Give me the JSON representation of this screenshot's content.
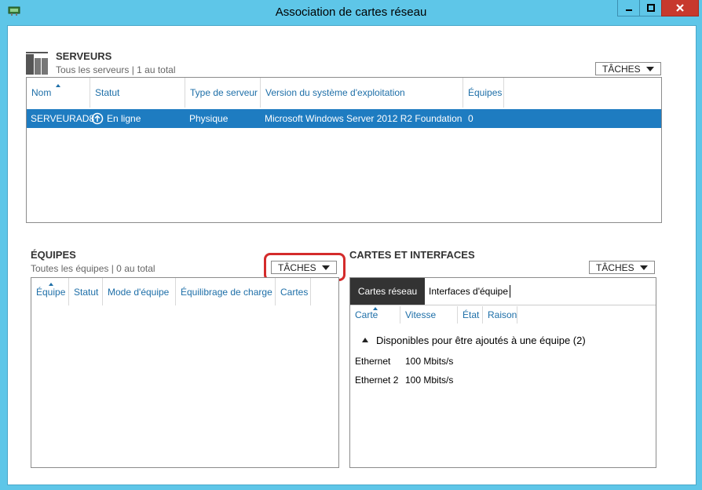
{
  "window": {
    "title": "Association de cartes réseau"
  },
  "servers": {
    "title": "SERVEURS",
    "subtitle": "Tous les serveurs | 1 au total",
    "tasks_label": "TÂCHES",
    "columns": [
      "Nom",
      "Statut",
      "Type de serveur",
      "Version du système d'exploitation",
      "Équipes"
    ],
    "rows": [
      {
        "name": "SERVEURAD8",
        "status": "En ligne",
        "type": "Physique",
        "os": "Microsoft Windows Server 2012 R2 Foundation",
        "teams": "0"
      }
    ]
  },
  "teams": {
    "title": "ÉQUIPES",
    "subtitle": "Toutes les équipes | 0 au total",
    "tasks_label": "TÂCHES",
    "columns": [
      "Équipe",
      "Statut",
      "Mode d'équipe",
      "Équilibrage de charge",
      "Cartes"
    ]
  },
  "adapters": {
    "title": "CARTES ET INTERFACES",
    "tasks_label": "TÂCHES",
    "tabs": [
      "Cartes réseau",
      "Interfaces d'équipe"
    ],
    "columns": [
      "Carte",
      "Vitesse",
      "État",
      "Raison"
    ],
    "group_label": "Disponibles pour être ajoutés à une équipe (2)",
    "rows": [
      {
        "name": "Ethernet",
        "speed": "100 Mbits/s"
      },
      {
        "name": "Ethernet 2",
        "speed": "100 Mbits/s"
      }
    ]
  },
  "colors": {
    "accent": "#1e7cc1",
    "titlebar": "#5ec6e8",
    "close": "#c7392d",
    "highlight": "#d42b2b"
  }
}
